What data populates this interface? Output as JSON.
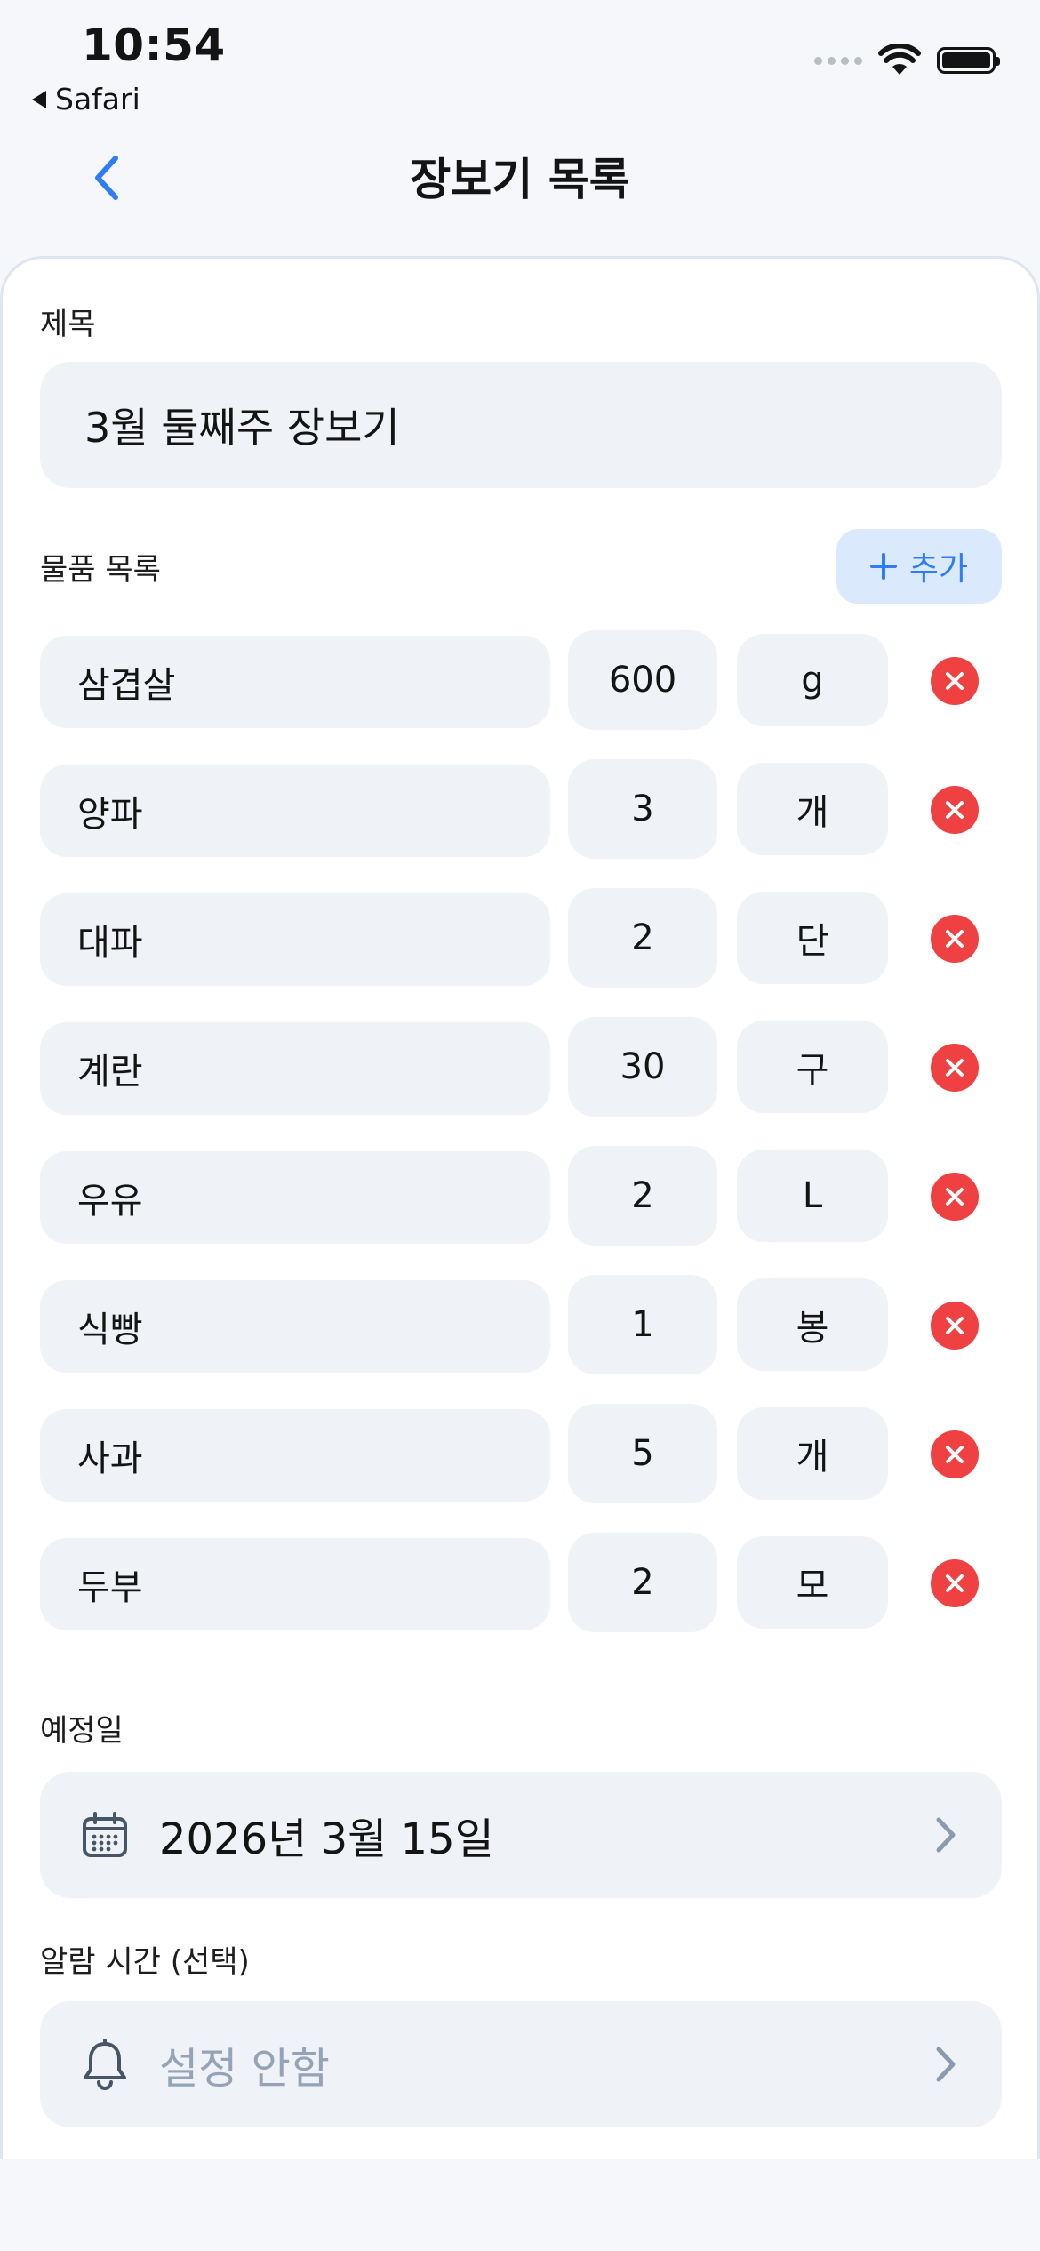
{
  "status_bar": {
    "time": "10:54",
    "back_app": "Safari"
  },
  "nav": {
    "title": "장보기 목록"
  },
  "form": {
    "title_label": "제목",
    "title_value": "3월 둘째주 장보기",
    "items_label": "물품 목록",
    "add_label": "추가",
    "items": [
      {
        "name": "삼겹살",
        "qty": "600",
        "unit": "g"
      },
      {
        "name": "양파",
        "qty": "3",
        "unit": "개"
      },
      {
        "name": "대파",
        "qty": "2",
        "unit": "단"
      },
      {
        "name": "계란",
        "qty": "30",
        "unit": "구"
      },
      {
        "name": "우유",
        "qty": "2",
        "unit": "L"
      },
      {
        "name": "식빵",
        "qty": "1",
        "unit": "봉"
      },
      {
        "name": "사과",
        "qty": "5",
        "unit": "개"
      },
      {
        "name": "두부",
        "qty": "2",
        "unit": "모"
      }
    ],
    "date_label": "예정일",
    "date_value": "2026년 3월 15일",
    "alarm_label": "알람 시간 (선택)",
    "alarm_placeholder": "설정 안함"
  },
  "colors": {
    "accent": "#2f7cf6",
    "remove": "#ef4141",
    "field_bg": "#eff3f8",
    "placeholder": "#94a3b8"
  },
  "icons": {
    "back": "chevron-left-icon",
    "add": "plus-icon",
    "remove": "close-circle-icon",
    "date": "calendar-icon",
    "alarm": "bell-icon",
    "disclosure": "chevron-right-icon"
  }
}
